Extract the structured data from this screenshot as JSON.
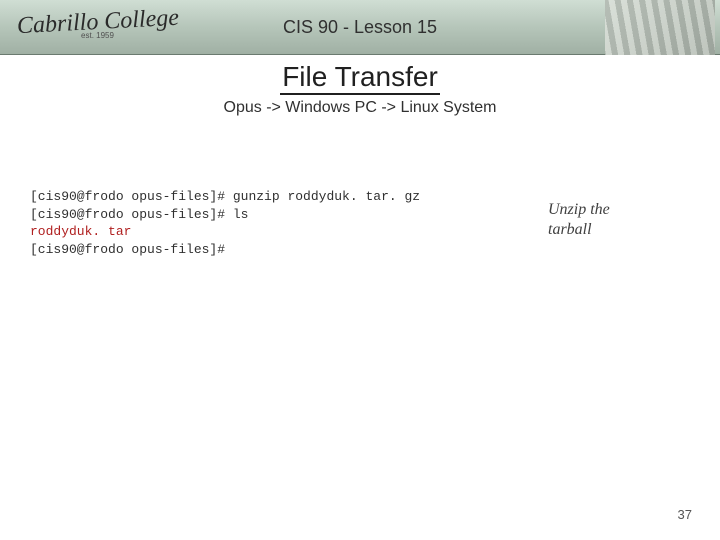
{
  "header": {
    "logo_main": "Cabrillo College",
    "logo_sub": "est. 1959",
    "title": "CIS 90 - Lesson 15"
  },
  "title": "File Transfer",
  "subtitle": "Opus -> Windows PC -> Linux System",
  "terminal": {
    "line1_prompt": "[cis90@frodo opus-files]# ",
    "line1_cmd": "gunzip roddyduk. tar. gz",
    "line2_prompt": "[cis90@frodo opus-files]# ",
    "line2_cmd": "ls",
    "line3": "roddyduk. tar",
    "line4": "[cis90@frodo opus-files]#"
  },
  "annotation": {
    "l1": "Unzip the",
    "l2": "tarball"
  },
  "slide_number": "37"
}
